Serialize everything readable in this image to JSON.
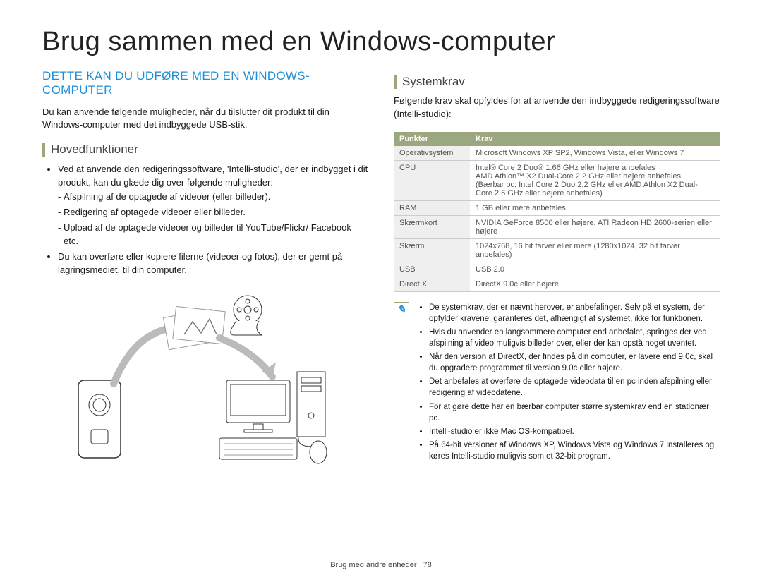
{
  "page_title": "Brug sammen med en Windows-computer",
  "section_title": "DETTE KAN DU UDFØRE MED EN WINDOWS-COMPUTER",
  "intro": "Du kan anvende følgende muligheder, når du tilslutter dit produkt til din Windows-computer med det indbyggede USB-stik.",
  "left": {
    "subhead": "Hovedfunktioner",
    "b1": "Ved at anvende den redigeringssoftware, 'Intelli-studio', der er indbygget i dit produkt, kan du glæde dig over følgende muligheder:",
    "b1a": "Afspilning af de optagede af videoer (eller billeder).",
    "b1b": "Redigering af optagede videoer eller billeder.",
    "b1c": "Upload af de optagede videoer og billeder til YouTube/Flickr/ Facebook etc.",
    "b2": "Du kan overføre eller kopiere filerne (videoer og fotos), der er gemt på lagringsmediet, til din computer."
  },
  "right": {
    "subhead": "Systemkrav",
    "intro": "Følgende krav skal opfyldes for at anvende den indbyggede redigeringssoftware (Intelli-studio):",
    "th_item": "Punkter",
    "th_req": "Krav",
    "rows": [
      {
        "k": "Operativsystem",
        "v": "Microsoft Windows XP SP2, Windows Vista, eller Windows 7"
      },
      {
        "k": "CPU",
        "v": "Intel® Core 2 Duo® 1.66 GHz eller højere anbefales\nAMD Athlon™ X2 Dual-Core 2.2 GHz eller højere anbefales\n(Bærbar pc: Intel Core 2 Duo 2,2 GHz eller AMD Athlon X2 Dual-Core 2,6 GHz eller højere anbefales)"
      },
      {
        "k": "RAM",
        "v": "1 GB eller mere anbefales"
      },
      {
        "k": "Skærmkort",
        "v": "NVIDIA GeForce 8500 eller højere, ATI Radeon HD 2600-serien eller højere"
      },
      {
        "k": "Skærm",
        "v": "1024x768, 16 bit farver eller mere (1280x1024, 32 bit farver anbefales)"
      },
      {
        "k": "USB",
        "v": "USB 2.0"
      },
      {
        "k": "Direct X",
        "v": "DirectX 9.0c eller højere"
      }
    ],
    "notes": [
      "De systemkrav, der er nævnt herover, er anbefalinger. Selv på et system, der opfylder kravene, garanteres det, afhængigt af systemet, ikke for funktionen.",
      "Hvis du anvender en langsommere computer end anbefalet, springes der ved afspilning af video muligvis billeder over, eller der kan opstå noget uventet.",
      "Når den version af DirectX, der findes på din computer, er lavere end 9.0c, skal du opgradere programmet til version 9.0c eller højere.",
      "Det anbefales at overføre de optagede videodata til en pc inden afspilning eller redigering af videodatene.",
      "For at gøre dette har en bærbar computer større systemkrav end en stationær pc.",
      "Intelli-studio er ikke Mac OS-kompatibel.",
      "På 64-bit versioner af Windows XP, Windows Vista og Windows 7 installeres og køres Intelli-studio muligvis som et 32-bit program."
    ]
  },
  "footer_label": "Brug med andre enheder",
  "page_number": "78"
}
